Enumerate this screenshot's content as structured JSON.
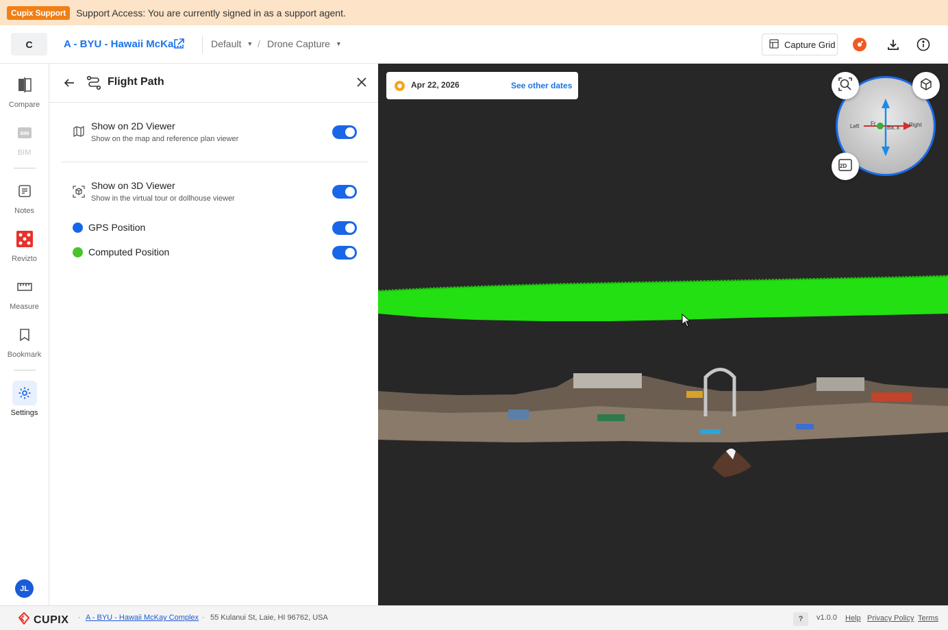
{
  "banner": {
    "badge": "Cupix Support",
    "message": "Support Access: You are currently signed in as a support agent."
  },
  "header": {
    "org_initial": "C",
    "project_name": "A - BYU - Hawaii McKa...",
    "view_select": "Default",
    "capture_select": "Drone Capture",
    "breadcrumb_sep": "/",
    "capture_grid_label": "Capture Grid",
    "icons": [
      "external-link-icon",
      "grid-icon",
      "revizto-icon",
      "download-icon",
      "info-icon"
    ]
  },
  "leftnav": {
    "items": [
      {
        "key": "compare",
        "label": "Compare",
        "icon": "compare-icon"
      },
      {
        "key": "bim",
        "label": "BIM",
        "icon": "bim-icon"
      },
      {
        "key": "notes",
        "label": "Notes",
        "icon": "notes-icon"
      },
      {
        "key": "revizto",
        "label": "Revizto",
        "icon": "revizto-icon"
      },
      {
        "key": "measure",
        "label": "Measure",
        "icon": "ruler-icon"
      },
      {
        "key": "bookmark",
        "label": "Bookmark",
        "icon": "bookmark-icon"
      },
      {
        "key": "settings",
        "label": "Settings",
        "icon": "gear-icon"
      }
    ],
    "avatar_initials": "JL",
    "colors": {
      "active_bg": "#e8f0fd",
      "revizto": "#e9302a",
      "accent": "#1a66e8"
    }
  },
  "panel": {
    "title": "Flight Path",
    "rows": [
      {
        "title": "Show on 2D Viewer",
        "subtitle": "Show on the map and reference plan viewer",
        "enabled": true
      },
      {
        "title": "Show on 3D Viewer",
        "subtitle": "Show in the virtual tour or dollhouse viewer",
        "enabled": true
      }
    ],
    "positions": [
      {
        "label": "GPS Position",
        "color": "#1566e8",
        "enabled": true
      },
      {
        "label": "Computed Position",
        "color": "#4cc22a",
        "enabled": true
      }
    ]
  },
  "viewer": {
    "date": "Apr 22, 2026",
    "other_dates_label": "See other dates",
    "gizmo_labels": {
      "left": "Left",
      "front": "Fr",
      "back": "Ba..k",
      "right": "Right"
    },
    "button_2d": "2D"
  },
  "footer": {
    "brand": "CUPIX",
    "project_link": "A - BYU - Hawaii McKay Complex",
    "address": "55 Kulanui St, Laie, HI 96762, USA",
    "help_badge": "?",
    "version": "v1.0.0",
    "links": {
      "help": "Help",
      "privacy": "Privacy Policy",
      "terms": "Terms"
    }
  }
}
